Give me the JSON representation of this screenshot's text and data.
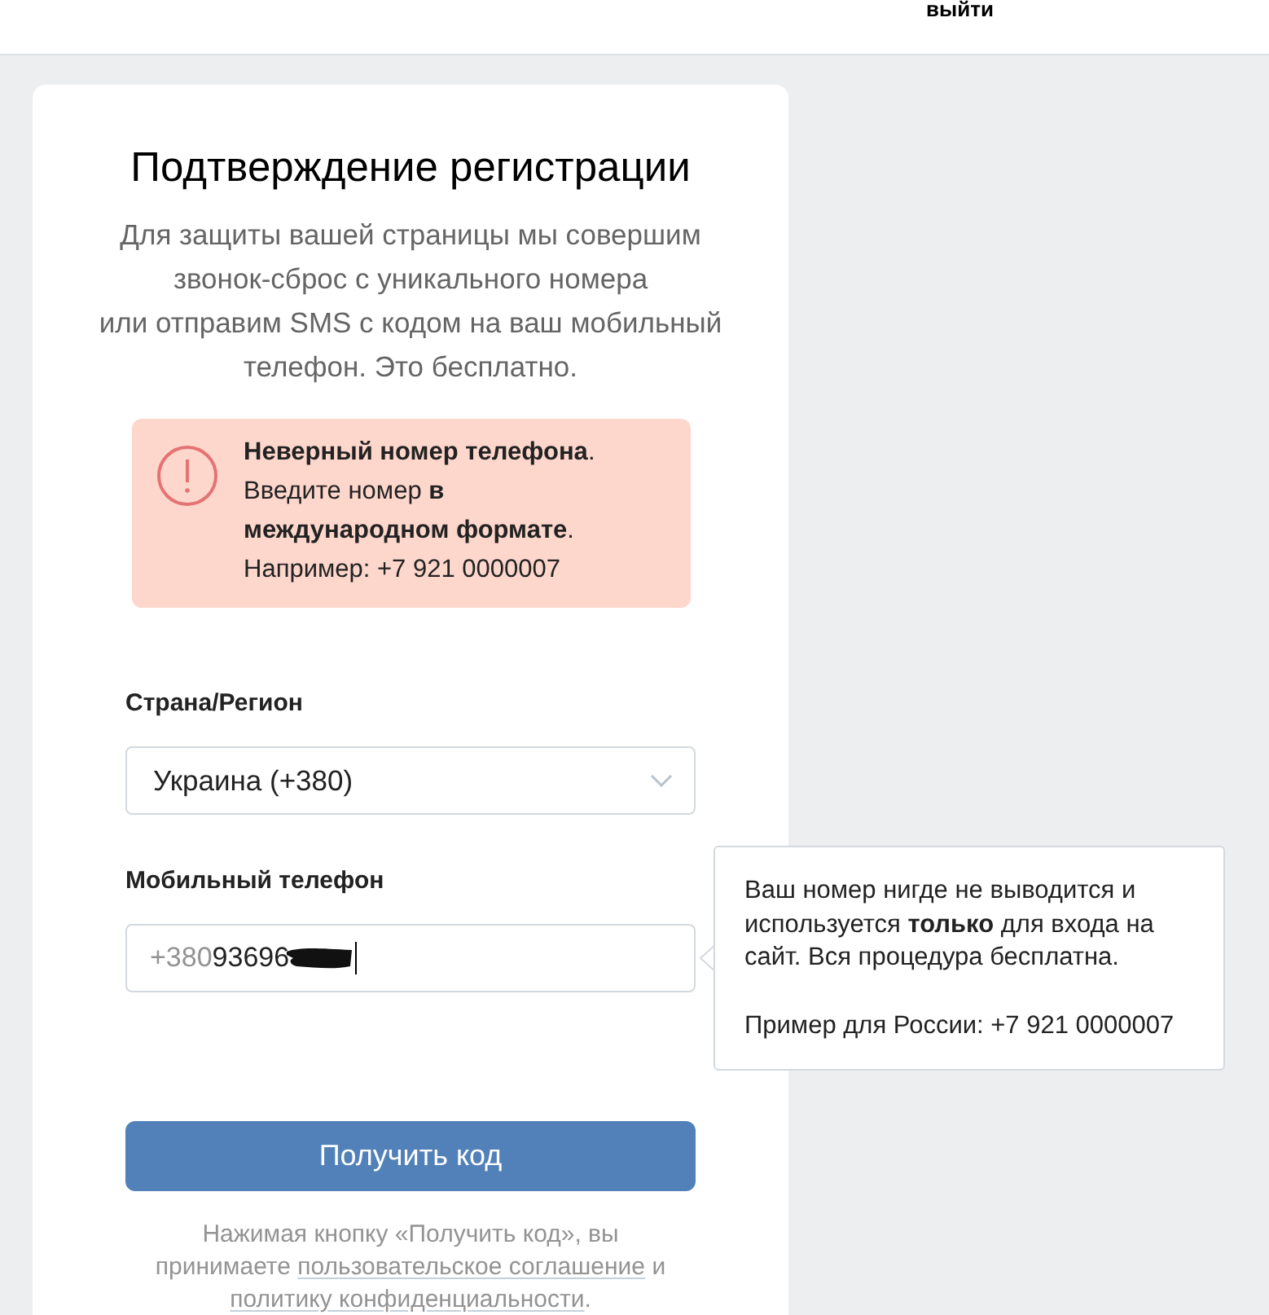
{
  "header": {
    "logout_link": "выйти"
  },
  "card": {
    "title": "Подтверждение регистрации",
    "description": "Для защиты вашей страницы мы совершим звонок-сброс с уникального номера\nили отправим SMS с кодом на ваш мобильный телефон. Это бесплатно."
  },
  "alert": {
    "kind": "error",
    "text": "**Неверный номер телефона**.\nВведите номер **в международном формате**.\nНапример: +7 921 0000007"
  },
  "fields": [
    {
      "kind": "select",
      "label": "Страна/Регион",
      "value": "Украина (+380)"
    },
    {
      "kind": "phone",
      "label": "Мобильный телефон",
      "prefix": "+380",
      "value": "93696",
      "redacted": true,
      "focused": true
    }
  ],
  "tooltip": {
    "text": "Ваш номер нигде не выводится и используется **только** для входа на сайт. Вся процедура бесплатна.",
    "example": "Пример для России: +7 921 0000007"
  },
  "submit_button": "Получить код",
  "legal": [
    {
      "kind": "text",
      "text": "Нажимая кнопку «Получить код», вы принимаете "
    },
    {
      "kind": "link",
      "text": "пользовательское соглашение"
    },
    {
      "kind": "text",
      "text": " и "
    },
    {
      "kind": "link",
      "text": "политику конфиденциальности"
    },
    {
      "kind": "text",
      "text": "."
    }
  ]
}
